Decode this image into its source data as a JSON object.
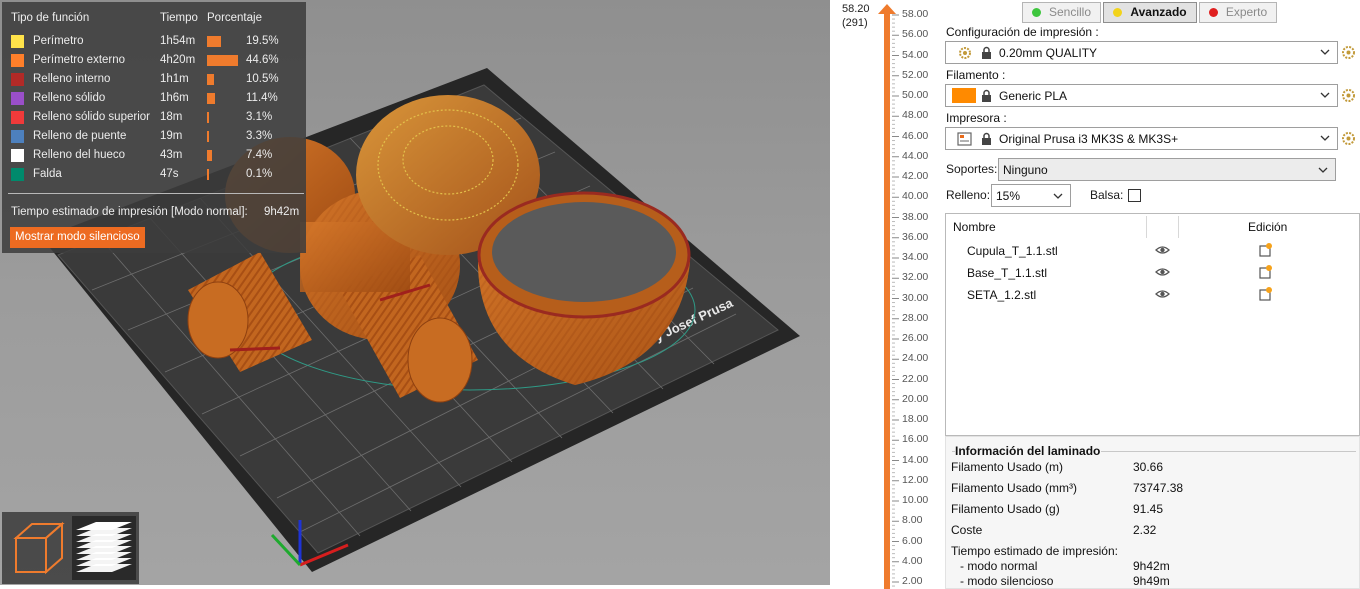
{
  "legend": {
    "headers": {
      "feature": "Tipo de función",
      "time": "Tiempo",
      "percent": "Porcentaje"
    },
    "rows": [
      {
        "name": "Perímetro",
        "time": "1h54m",
        "percent": "19.5%",
        "color": "#ffe34a",
        "fraction": 0.195
      },
      {
        "name": "Perímetro externo",
        "time": "4h20m",
        "percent": "44.6%",
        "color": "#ff7f2a",
        "fraction": 0.446
      },
      {
        "name": "Relleno interno",
        "time": "1h1m",
        "percent": "10.5%",
        "color": "#b22a27",
        "fraction": 0.105
      },
      {
        "name": "Relleno sólido",
        "time": "1h6m",
        "percent": "11.4%",
        "color": "#9a4fc9",
        "fraction": 0.114
      },
      {
        "name": "Relleno sólido superior",
        "time": "18m",
        "percent": "3.1%",
        "color": "#f03a3a",
        "fraction": 0.031
      },
      {
        "name": "Relleno de puente",
        "time": "19m",
        "percent": "3.3%",
        "color": "#4d80bd",
        "fraction": 0.033
      },
      {
        "name": "Relleno del hueco",
        "time": "43m",
        "percent": "7.4%",
        "color": "#ffffff",
        "fraction": 0.074
      },
      {
        "name": "Falda",
        "time": "47s",
        "percent": "0.1%",
        "color": "#008a6c",
        "fraction": 0.001
      }
    ],
    "estimated_label": "Tiempo estimado de impresión [Modo normal]:",
    "estimated_value": "9h42m",
    "silent_button": "Mostrar modo silencioso"
  },
  "viewport": {
    "bed_brand": "by Josef Prusa",
    "view_toggle": {
      "left_icon": "3d-view-icon",
      "right_icon": "layers-view-icon"
    }
  },
  "layer_slider": {
    "top_value": "58.20",
    "top_layer": "(291)",
    "labels": [
      "58.00",
      "56.00",
      "54.00",
      "52.00",
      "50.00",
      "48.00",
      "46.00",
      "44.00",
      "42.00",
      "40.00",
      "38.00",
      "36.00",
      "34.00",
      "32.00",
      "30.00",
      "28.00",
      "26.00",
      "24.00",
      "22.00",
      "20.00",
      "18.00",
      "16.00",
      "14.00",
      "12.00",
      "10.00",
      "8.00",
      "6.00",
      "4.00",
      "2.00"
    ],
    "accent": "#ef7b2d"
  },
  "sidebar": {
    "modes": [
      {
        "label": "Sencillo",
        "dot": "#3ec63e"
      },
      {
        "label": "Avanzado",
        "dot": "#f2d31a"
      },
      {
        "label": "Experto",
        "dot": "#e02020"
      }
    ],
    "print_config": {
      "label": "Configuración de impresión :",
      "value": "0.20mm QUALITY"
    },
    "filament": {
      "label": "Filamento :",
      "value": "Generic PLA",
      "color": "#ff8a00"
    },
    "printer": {
      "label": "Impresora :",
      "value": "Original Prusa i3 MK3S & MK3S+"
    },
    "supports": {
      "label": "Soportes:",
      "value": "Ninguno"
    },
    "infill": {
      "label": "Relleno:",
      "value": "15%"
    },
    "brim": {
      "label": "Balsa:"
    },
    "object_list": {
      "col_name": "Nombre",
      "col_edit": "Edición",
      "items": [
        "Cupula_T_1.1.stl",
        "Base_T_1.1.stl",
        "SETA_1.2.stl"
      ]
    },
    "slice_info": {
      "title": "Información del laminado",
      "rows": [
        {
          "k": "Filamento Usado (m)",
          "v": "30.66"
        },
        {
          "k": "Filamento Usado (mm³)",
          "v": "73747.38"
        },
        {
          "k": "Filamento Usado (g)",
          "v": "91.45"
        },
        {
          "k": "Coste",
          "v": "2.32"
        }
      ],
      "time_title": "Tiempo estimado de impresión:",
      "normal_label": "- modo normal",
      "normal_value": "9h42m",
      "silent_label": "- modo silencioso",
      "silent_value": "9h49m"
    }
  }
}
